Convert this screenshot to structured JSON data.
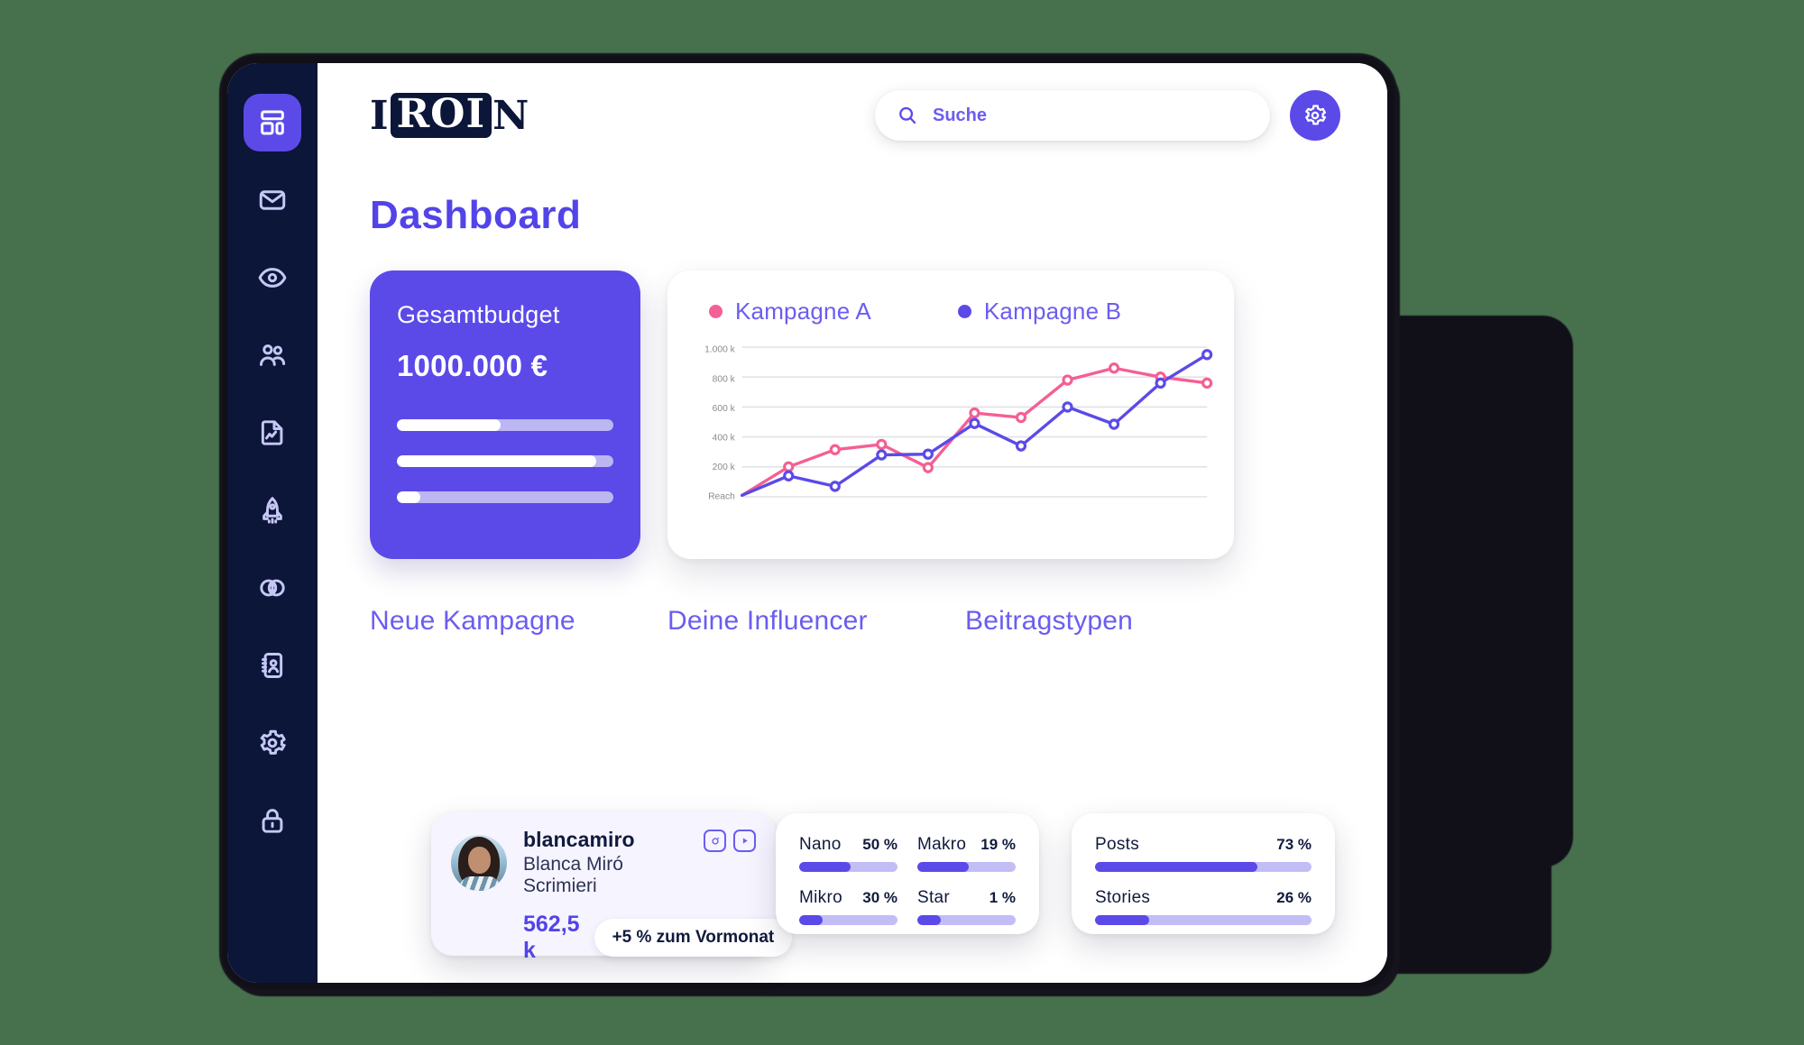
{
  "background_color": "#47704d",
  "brand": {
    "accent": "#5b4ae8",
    "dark": "#0b1638",
    "pink": "#f45f95"
  },
  "sidebar": {
    "items": [
      {
        "name": "dashboard",
        "icon": "dashboard-icon",
        "active": true
      },
      {
        "name": "messages",
        "icon": "mail-icon",
        "active": false
      },
      {
        "name": "monitoring",
        "icon": "eye-icon",
        "active": false
      },
      {
        "name": "influencers",
        "icon": "users-icon",
        "active": false
      },
      {
        "name": "reports",
        "icon": "document-chart-icon",
        "active": false
      },
      {
        "name": "campaigns",
        "icon": "rocket-icon",
        "active": false
      },
      {
        "name": "integrations",
        "icon": "venn-circles-icon",
        "active": false
      },
      {
        "name": "contacts",
        "icon": "contact-book-icon",
        "active": false
      },
      {
        "name": "settings",
        "icon": "gear-icon",
        "active": false
      },
      {
        "name": "security",
        "icon": "lock-icon",
        "active": false
      }
    ]
  },
  "header": {
    "logo": {
      "prefix": "I",
      "boxed": "ROI",
      "suffix": "N",
      "full": "IROIN"
    },
    "search": {
      "placeholder": "Suche",
      "value": ""
    },
    "settings_button_icon": "gear-icon"
  },
  "page_title": "Dashboard",
  "budget_card": {
    "title": "Gesamtbudget",
    "amount": "1000.000 €",
    "bars": [
      48,
      92,
      11
    ]
  },
  "chart_card": {
    "legend": [
      {
        "label": "Kampagne A",
        "color": "#f45f95"
      },
      {
        "label": "Kampagne B",
        "color": "#5b4ae8"
      }
    ]
  },
  "chart_data": {
    "type": "line",
    "title": "",
    "xlabel": "",
    "ylabel": "Reach",
    "ylim": [
      0,
      1000
    ],
    "grid": true,
    "legend_position": "top",
    "y_ticks": [
      "Reach",
      "200 k",
      "400 k",
      "600 k",
      "800 k",
      "1.000 k"
    ],
    "y_tick_values": [
      0,
      200,
      400,
      600,
      800,
      1000
    ],
    "x": [
      1,
      2,
      3,
      4,
      5,
      6,
      7,
      8,
      9,
      10,
      11
    ],
    "series": [
      {
        "name": "Kampagne A",
        "color": "#f45f95",
        "values": [
          10,
          200,
          315,
          350,
          195,
          560,
          530,
          780,
          860,
          800,
          760
        ]
      },
      {
        "name": "Kampagne B",
        "color": "#5b4ae8",
        "values": [
          10,
          140,
          70,
          280,
          285,
          490,
          340,
          600,
          485,
          760,
          950
        ]
      }
    ]
  },
  "sections": {
    "new_campaign": "Neue Kampagne",
    "your_influencers": "Deine Influencer",
    "post_types": "Beitragstypen"
  },
  "influencer_card": {
    "handle": "blancamiro",
    "full_name": "Blanca Miró Scrimieri",
    "reach": "562,5 k",
    "change_badge": "+5 % zum Vormonat",
    "socials": [
      "instagram-icon",
      "youtube-icon"
    ]
  },
  "influencer_stats": {
    "rows": [
      {
        "label": "Nano",
        "percent_text": "50 %",
        "fill": 52
      },
      {
        "label": "Makro",
        "percent_text": "19 %",
        "fill": 52
      },
      {
        "label": "Mikro",
        "percent_text": "30 %",
        "fill": 24
      },
      {
        "label": "Star",
        "percent_text": "1 %",
        "fill": 24
      }
    ]
  },
  "post_types_stats": {
    "rows": [
      {
        "label": "Posts",
        "percent_text": "73 %",
        "fill": 75
      },
      {
        "label": "Stories",
        "percent_text": "26 %",
        "fill": 25
      }
    ]
  }
}
